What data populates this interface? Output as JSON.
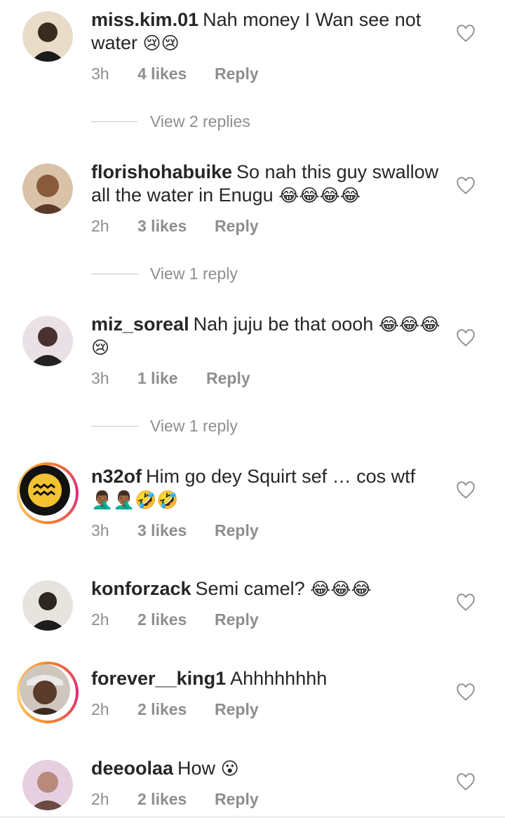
{
  "comments": [
    {
      "user": "miss.kim.01",
      "text": "Nah money I Wan see not water",
      "emoji": "😢😢",
      "time": "3h",
      "likes": "4 likes",
      "reply": "Reply",
      "view_replies": "View 2 replies",
      "avatar_color": "#3a2a22"
    },
    {
      "user": "florishohabuike",
      "text": "So nah this guy swallow all the water in Enugu",
      "emoji": "😂😂😂😂",
      "time": "2h",
      "likes": "3 likes",
      "reply": "Reply",
      "view_replies": "View 1 reply",
      "avatar_color": "#8a5a3c"
    },
    {
      "user": "miz_soreal",
      "text": "Nah juju be that oooh",
      "emoji": "😂😂😂😢",
      "time": "3h",
      "likes": "1 like",
      "reply": "Reply",
      "view_replies": "View 1 reply",
      "avatar_color": "#4a3030"
    },
    {
      "user": "n32of",
      "text": "Him go dey Squirt sef … cos wtf",
      "emoji": "🤦🏾‍♂️🤦🏾‍♂️🤣🤣",
      "time": "3h",
      "likes": "3 likes",
      "reply": "Reply",
      "avatar_color": "#111111"
    },
    {
      "user": "konforzack",
      "text": "Semi camel?",
      "emoji": "😂😂😂",
      "time": "2h",
      "likes": "2 likes",
      "reply": "Reply",
      "avatar_color": "#2d2622"
    },
    {
      "user": "forever__king1",
      "text": "Ahhhhhhhh",
      "emoji": "",
      "time": "2h",
      "likes": "2 likes",
      "reply": "Reply",
      "avatar_color": "#5a3b2a"
    },
    {
      "user": "deeoolaa",
      "text": "How",
      "emoji": "😮",
      "time": "2h",
      "likes": "2 likes",
      "reply": "Reply",
      "avatar_color": "#b88a7a"
    }
  ],
  "icons": {
    "like": "heart-icon",
    "zodiac": "aquarius-icon"
  }
}
